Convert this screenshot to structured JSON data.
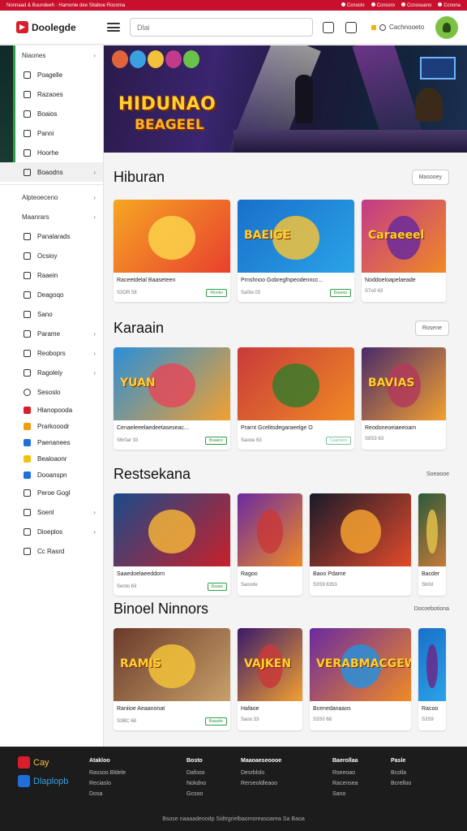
{
  "topbar": {
    "left_text": "Nonnaad & Buundeeh · Hamonie dee Sitabue Rocoma",
    "right_items": [
      "Ccnoclo",
      "Ccnsoro",
      "Ccnosuano",
      "Ccnona"
    ]
  },
  "header": {
    "logo_text": "Doolegde",
    "search_placeholder": "Dlai",
    "search_label": "Cachnooeto"
  },
  "sidebar": {
    "items": [
      {
        "label": "Niaones",
        "chevron": "›"
      },
      {
        "label": "Poagelle"
      },
      {
        "label": "Razaoes"
      },
      {
        "label": "Boaios"
      },
      {
        "label": "Panni"
      },
      {
        "label": "Hoorhe"
      },
      {
        "label": "Boaodns",
        "chevron": "›"
      },
      {
        "label": "Alpteoeceno",
        "chevron": "›"
      },
      {
        "label": "Maanrars",
        "chevron": "›"
      },
      {
        "label": "Panalarads"
      },
      {
        "label": "Ocsioy"
      },
      {
        "label": "Raaein"
      },
      {
        "label": "Deagoqo"
      },
      {
        "label": "Sano"
      },
      {
        "label": "Parame",
        "chevron": "›"
      },
      {
        "label": "Reoboprs",
        "chevron": "›"
      },
      {
        "label": "Ragoleiy",
        "chevron": "›"
      },
      {
        "label": "Sesoslo"
      },
      {
        "label": "Hlanopooda"
      },
      {
        "label": "Prarkooodr"
      },
      {
        "label": "Paenanees"
      },
      {
        "label": "Bealoaonr"
      },
      {
        "label": "Dooanspn"
      },
      {
        "label": "Peroe Gogl"
      },
      {
        "label": "Soenl",
        "chevron": "›"
      },
      {
        "label": "Dioeplos",
        "chevron": "›"
      },
      {
        "label": "Cc Rasrd"
      }
    ]
  },
  "hero": {
    "title": "HIDUNAO",
    "subtitle": "BEAGEEL"
  },
  "sections": [
    {
      "title": "Hiburan",
      "more": "Masooey",
      "cards": [
        {
          "title": "Raceetdelal Baaseteen",
          "meta": "S3OR 58",
          "badge": "Rlonko",
          "word": "",
          "colors": [
            "#f6a623",
            "#e8402e",
            "#fbd44a"
          ]
        },
        {
          "title": "Prnshnoo Gobregfnpeodenncc...",
          "meta": "Sa0ta 03",
          "badge": "Baarep",
          "word": "BAEIGE",
          "colors": [
            "#1a6fc9",
            "#2aa3e8",
            "#f2c23a"
          ]
        },
        {
          "title": "Noddoeloapelaeade",
          "meta": "S7o0 63",
          "badge": "",
          "word": "Caraeeel",
          "colors": [
            "#c23a8a",
            "#f08a24",
            "#6b2a9a"
          ]
        }
      ]
    },
    {
      "title": "Karaain",
      "more": "Rosene",
      "cards": [
        {
          "title": "Cenaeleeelaedeetaseseac...",
          "meta": "S6r0ar 33",
          "badge": "Bsaano",
          "word": "YUAN",
          "colors": [
            "#2a8fd8",
            "#f2a030",
            "#e24a5a"
          ]
        },
        {
          "title": "Prarnt Gcelitsdegaraeelge O",
          "meta": "Saooe 63",
          "badge": "Caaroonr",
          "word": "",
          "colors": [
            "#c83a3a",
            "#f08a24",
            "#3a7a2a"
          ]
        },
        {
          "title": "Reodoneoeiaeeoam",
          "meta": "S8S3 63",
          "badge": "",
          "word": "BAVIAS",
          "colors": [
            "#4a2a6a",
            "#f2a030",
            "#b23a5a"
          ]
        }
      ]
    },
    {
      "title": "Restsekana",
      "more": "Soeaooe",
      "cards": [
        {
          "title": "Saaedoelaeeddorn",
          "meta": "Serdo 63",
          "badge": "Raaas",
          "word": "",
          "colors": [
            "#1a4a8a",
            "#c8202a",
            "#f2b23a"
          ]
        },
        {
          "title": "Ragoo",
          "meta": "Saoode",
          "badge": "",
          "word": "",
          "colors": [
            "#6a2aa0",
            "#f08a24",
            "#c83a3a"
          ]
        },
        {
          "title": "Baoo Pdame",
          "meta": "S3S9 6353",
          "badge": "",
          "word": "",
          "colors": [
            "#1a1a2a",
            "#e24a2a",
            "#f2a030"
          ]
        },
        {
          "title": "Bacder",
          "meta": "Sb0d",
          "badge": "",
          "word": "",
          "colors": [
            "#2a5a3a",
            "#c87a3a",
            "#e2c04a"
          ]
        }
      ]
    },
    {
      "title": "Binoel Ninnors",
      "more": "Docoebotiona",
      "cards": [
        {
          "title": "Raniioe Aeaanonat",
          "meta": "S3BC 68",
          "badge": "Baaode",
          "word": "RAMIS",
          "colors": [
            "#6a3a2a",
            "#c8a06a",
            "#f2c23a"
          ]
        },
        {
          "title": "Hafaoe",
          "meta": "Saoo 33",
          "badge": "",
          "word": "VAJKEN",
          "colors": [
            "#3a1a6a",
            "#f2a030",
            "#c83a3a"
          ]
        },
        {
          "title": "Bcenedanaaos",
          "meta": "S3S0 68",
          "badge": "",
          "word": "VERABMACGEWE",
          "colors": [
            "#6a2aa0",
            "#f08a24",
            "#2a8fd8"
          ]
        },
        {
          "title": "Racoo",
          "meta": "S3S9",
          "badge": "",
          "word": "",
          "colors": [
            "#1a6fc9",
            "#2aa3e8",
            "#6a2a8a"
          ]
        }
      ]
    }
  ],
  "footer": {
    "logo_top": "Cay",
    "logo_bottom": "Dlaplopb",
    "columns": [
      {
        "heading": "Atakloo",
        "links": [
          "Rassoo Bldele",
          "Reciaslo",
          "Dosa"
        ]
      },
      {
        "heading": "Bosto",
        "links": [
          "Dafooo",
          "Nokdno",
          "Gcsoo"
        ]
      },
      {
        "heading": "Maaoaeseoooe",
        "links": [
          "Desrblslo",
          "Rerseoldleaoo"
        ]
      },
      {
        "heading": "Baerollaa",
        "links": [
          "Rseeoao",
          "Racensea",
          "Sano"
        ]
      },
      {
        "heading": "Pasle",
        "links": [
          "Bcolla",
          "Bcrelloo"
        ]
      }
    ],
    "copyright": "Bsose naaaadeoodp Sidtrgrielbaomoreasoarea Sa Baoa"
  },
  "colors": {
    "brand_red": "#c8102e",
    "accent_green": "#2e9c45",
    "footer_bg": "#1c1c1c"
  }
}
